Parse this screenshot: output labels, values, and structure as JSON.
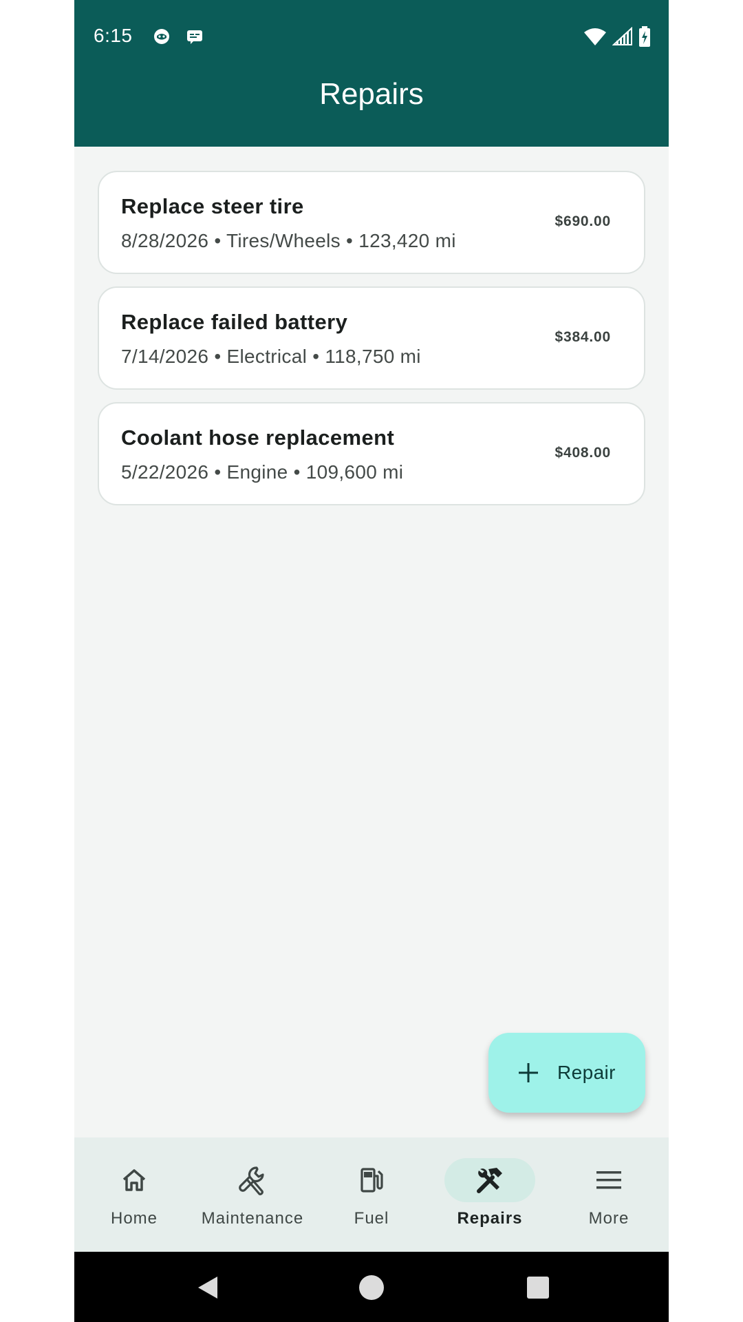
{
  "status_bar": {
    "time": "6:15"
  },
  "app_bar": {
    "title": "Repairs"
  },
  "repairs": [
    {
      "title": "Replace steer tire",
      "subtitle": "8/28/2026 • Tires/Wheels • 123,420 mi",
      "amount": "$690.00"
    },
    {
      "title": "Replace failed battery",
      "subtitle": "7/14/2026 • Electrical • 118,750 mi",
      "amount": "$384.00"
    },
    {
      "title": "Coolant hose replacement",
      "subtitle": "5/22/2026 • Engine • 109,600 mi",
      "amount": "$408.00"
    }
  ],
  "fab": {
    "label": "Repair",
    "icon": "plus-icon"
  },
  "bottom_nav": {
    "items": [
      {
        "label": "Home",
        "icon": "home-icon",
        "active": false
      },
      {
        "label": "Maintenance",
        "icon": "wrench-icon",
        "active": false
      },
      {
        "label": "Fuel",
        "icon": "fuel-pump-icon",
        "active": false
      },
      {
        "label": "Repairs",
        "icon": "hammer-wrench-icon",
        "active": true
      },
      {
        "label": "More",
        "icon": "menu-icon",
        "active": false
      }
    ]
  },
  "colors": {
    "primary": "#0b5c58",
    "background": "#f3f5f4",
    "fab": "#9ef2e9",
    "nav_background": "#e6eeec",
    "nav_active_pill": "#d3ebe5"
  }
}
